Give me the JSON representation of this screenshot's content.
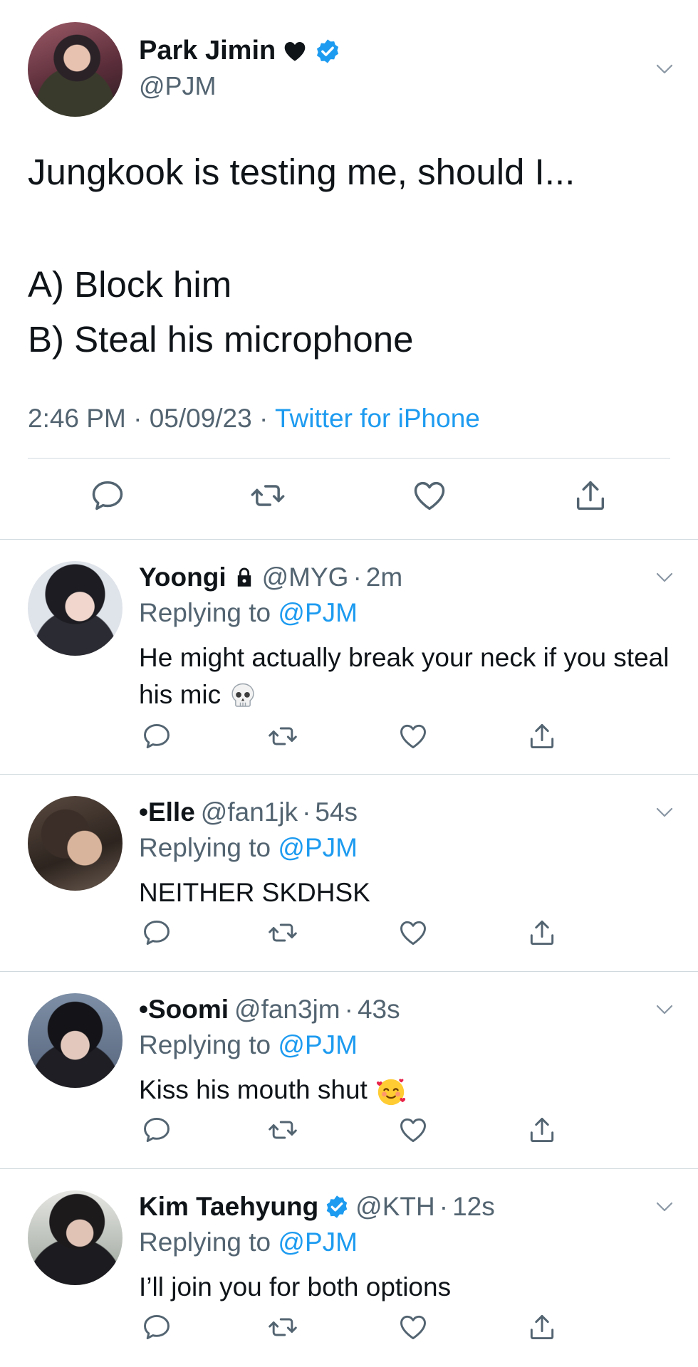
{
  "main": {
    "name": "Park Jimin",
    "handle": "@PJM",
    "text_line1": "Jungkook is testing me, should I...",
    "text_line2": "A) Block him",
    "text_line3": "B) Steal his microphone",
    "time": "2:46 PM",
    "date": "05/09/23",
    "separator": "·",
    "source": "Twitter for iPhone"
  },
  "replies": [
    {
      "name": "Yoongi",
      "handle": "@MYG",
      "time": "2m",
      "replying_label": "Replying to",
      "mention": "@PJM",
      "text": "He might actually break your neck if you steal his mic"
    },
    {
      "name": "•Elle",
      "handle": "@fan1jk",
      "time": "54s",
      "replying_label": "Replying to",
      "mention": "@PJM",
      "text": "NEITHER SKDHSK"
    },
    {
      "name": "•Soomi",
      "handle": "@fan3jm",
      "time": "43s",
      "replying_label": "Replying to",
      "mention": "@PJM",
      "text": "Kiss his mouth shut"
    },
    {
      "name": "Kim Taehyung",
      "handle": "@KTH",
      "time": "12s",
      "replying_label": "Replying to",
      "mention": "@PJM",
      "text": "I’ll join you for both options"
    }
  ],
  "dot": "·",
  "colors": {
    "accent": "#1d9bf0",
    "muted": "#536471",
    "text": "#0f1419",
    "divider": "#cfd9de"
  },
  "icons": [
    "reply-icon",
    "retweet-icon",
    "like-icon",
    "share-icon",
    "chevron-down-icon",
    "verified-badge-icon",
    "black-heart-icon",
    "lock-icon",
    "skull-emoji",
    "smiling-face-with-hearts-emoji"
  ]
}
